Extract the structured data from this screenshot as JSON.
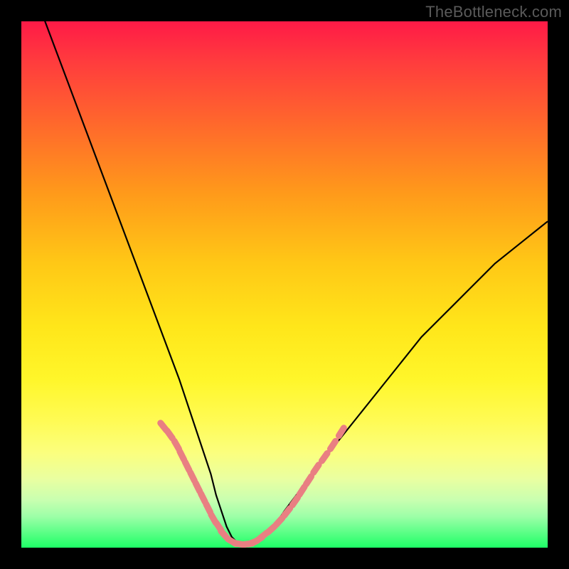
{
  "watermark": "TheBottleneck.com",
  "colors": {
    "frame": "#000000",
    "curve": "#000000",
    "marker": "#e97f82",
    "gradient_top": "#ff1a47",
    "gradient_bottom": "#1eff66"
  },
  "chart_data": {
    "type": "line",
    "title": "",
    "xlabel": "",
    "ylabel": "",
    "xlim": [
      0,
      100
    ],
    "ylim": [
      0,
      100
    ],
    "grid": false,
    "legend": false,
    "note": "V-shaped bottleneck curve on rainbow heatmap gradient; y likely represents bottleneck percentage (high=red, low=green); no axis ticks shown so x-values are normalized 0–100",
    "series": [
      {
        "name": "bottleneck-curve",
        "x": [
          0,
          3,
          6,
          9,
          12,
          15,
          18,
          21,
          24,
          27,
          30,
          32,
          34,
          36,
          37,
          38,
          39,
          40,
          41,
          42,
          43,
          44,
          46,
          48,
          50,
          53,
          56,
          60,
          64,
          68,
          72,
          76,
          80,
          85,
          90,
          95,
          100
        ],
        "y": [
          112,
          104,
          96,
          88,
          80,
          72,
          64,
          56,
          48,
          40,
          32,
          26,
          20,
          14,
          10,
          7,
          4,
          2,
          1,
          0.5,
          0.5,
          1,
          2,
          4,
          7,
          11,
          15,
          20,
          25,
          30,
          35,
          40,
          44,
          49,
          54,
          58,
          62
        ]
      }
    ],
    "markers": {
      "name": "highlighted-band",
      "note": "salmon dotted/segmented markers along curve roughly where y < ~23",
      "x": [
        27,
        28.2,
        29.5,
        30.5,
        31.5,
        32.5,
        33.5,
        34.5,
        35.5,
        36.5,
        37.5,
        38.5,
        40,
        41.5,
        43,
        44,
        45,
        46,
        47.5,
        49,
        50.5,
        52,
        53.3,
        54.6,
        56,
        57.6,
        59.2,
        60.8
      ],
      "y": [
        23,
        21.5,
        19.5,
        17.5,
        15.5,
        13.5,
        11.5,
        9.5,
        7.5,
        5.5,
        4,
        2.5,
        1.2,
        0.7,
        0.7,
        1,
        1.5,
        2.3,
        3.5,
        5,
        6.8,
        8.8,
        10.8,
        12.8,
        15,
        17.2,
        19.5,
        22
      ]
    }
  }
}
